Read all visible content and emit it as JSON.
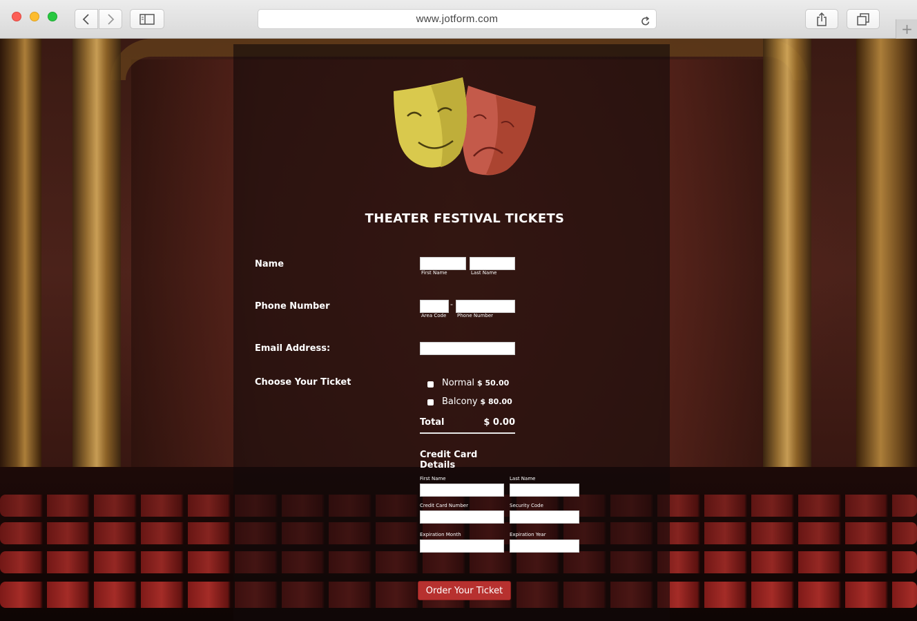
{
  "browser": {
    "url": "www.jotform.com"
  },
  "form": {
    "title": "THEATER FESTIVAL TICKETS",
    "name": {
      "label": "Name",
      "first_sub": "First Name",
      "last_sub": "Last Name",
      "first_value": "",
      "last_value": ""
    },
    "phone": {
      "label": "Phone Number",
      "area_sub": "Area Code",
      "number_sub": "Phone Number",
      "separator": "-"
    },
    "email": {
      "label": "Email Address:"
    },
    "ticket": {
      "label": "Choose Your Ticket",
      "options": [
        {
          "name": "Normal",
          "price": "$ 50.00",
          "checked": false
        },
        {
          "name": "Balcony",
          "price": "$ 80.00",
          "checked": false
        }
      ],
      "total_label": "Total",
      "total_value": "$ 0.00"
    },
    "credit_card": {
      "title": "Credit Card Details",
      "first_name": "First Name",
      "last_name": "Last Name",
      "card_number": "Credit Card Number",
      "security_code": "Security Code",
      "exp_month": "Expiration Month",
      "exp_year": "Expiration Year"
    },
    "submit_label": "Order Your Ticket"
  },
  "colors": {
    "submit": "#b7312f",
    "mask_happy": "#d9c94d",
    "mask_sad": "#c45a4a"
  }
}
